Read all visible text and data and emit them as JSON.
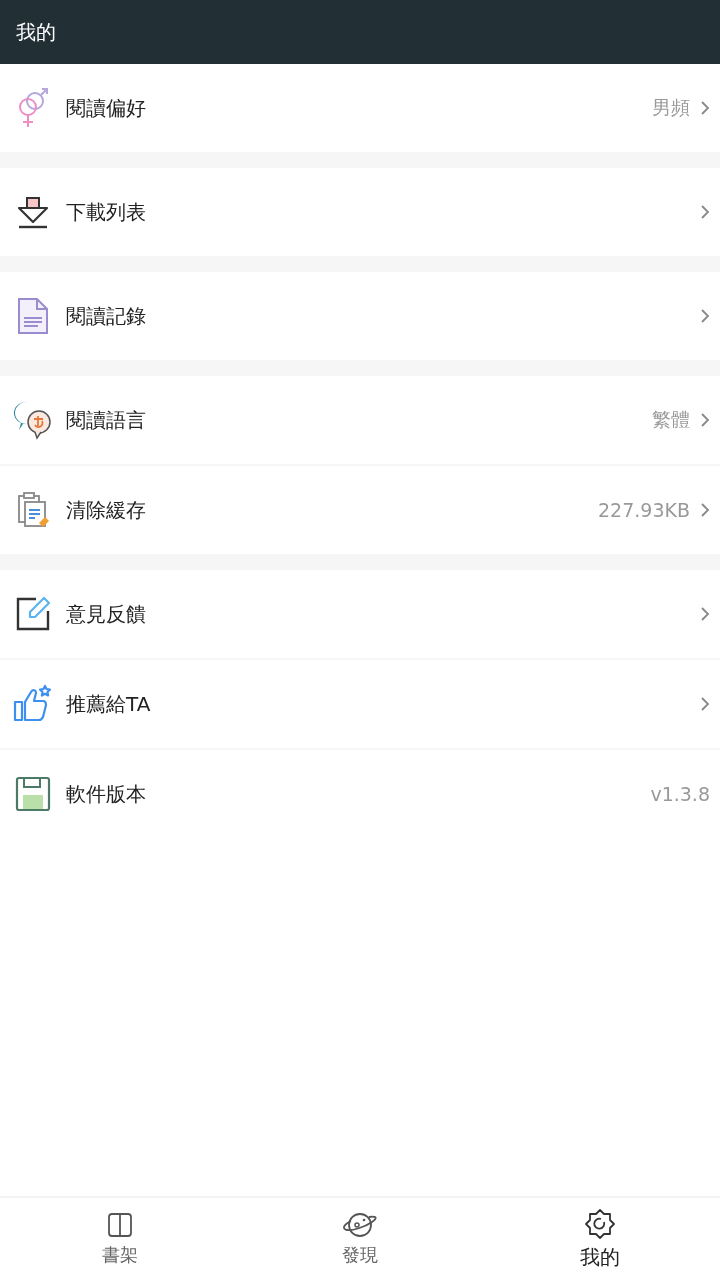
{
  "header": {
    "title": "我的"
  },
  "groups": [
    [
      {
        "kind": "gender",
        "label": "閱讀偏好",
        "value": "男頻",
        "arrow": true
      }
    ],
    [
      {
        "kind": "download",
        "label": "下載列表",
        "arrow": true
      }
    ],
    [
      {
        "kind": "document",
        "label": "閱讀記錄",
        "arrow": true
      }
    ],
    [
      {
        "kind": "language",
        "label": "閱讀語言",
        "value": "繁體",
        "arrow": true
      },
      {
        "kind": "clipboard",
        "label": "清除緩存",
        "value": "227.93KB",
        "arrow": true
      }
    ],
    [
      {
        "kind": "edit",
        "label": "意見反饋",
        "arrow": true
      },
      {
        "kind": "thumb",
        "label": "推薦給TA",
        "arrow": true
      },
      {
        "kind": "save",
        "label": "軟件版本",
        "value": "v1.3.8",
        "arrow": false
      }
    ]
  ],
  "tabs": [
    {
      "kind": "book",
      "label": "書架",
      "selected": false
    },
    {
      "kind": "planet",
      "label": "發現",
      "selected": false
    },
    {
      "kind": "gear",
      "label": "我的",
      "selected": true
    }
  ]
}
